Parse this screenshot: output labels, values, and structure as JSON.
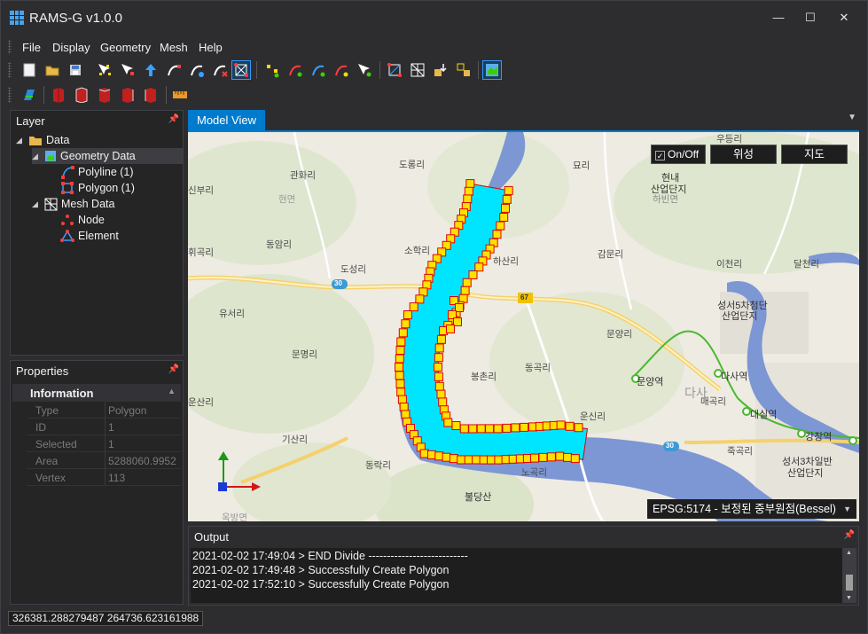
{
  "window": {
    "title": "RAMS-G v1.0.0",
    "minimize": "—",
    "maximize": "☐",
    "close": "✕"
  },
  "menu": [
    "File",
    "Display",
    "Geometry",
    "Mesh",
    "Help"
  ],
  "toolbar_icons_row1": [
    "new-file-icon",
    "open-folder-icon",
    "save-icon",
    "select-node-icon",
    "move-node-icon",
    "add-node-icon",
    "add-polyline-icon",
    "edit-polyline-icon",
    "delete-polyline-icon",
    "divide-polygon-icon",
    "select-point-icon",
    "polyline-point-icon",
    "add-line-icon",
    "merge-line-icon",
    "node-edit-icon",
    "create-polygon-icon",
    "mesh-grid-icon",
    "import-mesh-icon",
    "export-mesh-icon",
    "map-view-icon"
  ],
  "toolbar_icons_row2": [
    "interpolate-icon",
    "cube-red-1-icon",
    "cube-red-2-icon",
    "cube-red-3-icon",
    "cube-red-4-icon",
    "cube-red-5-icon",
    "ruler-icon"
  ],
  "layer": {
    "title": "Layer",
    "items": {
      "data": "Data",
      "geometry": "Geometry Data",
      "polyline": "Polyline (1)",
      "polygon": "Polygon (1)",
      "mesh": "Mesh Data",
      "node": "Node",
      "element": "Element"
    }
  },
  "properties": {
    "title": "Properties",
    "group": "Information",
    "rows": [
      {
        "key": "Type",
        "value": "Polygon"
      },
      {
        "key": "ID",
        "value": "1"
      },
      {
        "key": "Selected",
        "value": "1"
      },
      {
        "key": "Area",
        "value": "5288060.9952"
      },
      {
        "key": "Vertex",
        "value": "113"
      }
    ]
  },
  "model_view": {
    "tab": "Model View",
    "onoff_label": "On/Off",
    "satellite_btn": "위성",
    "map_btn": "지도",
    "crs": "EPSG:5174 - 보정된 중부원점(Bessel)",
    "map_labels": {
      "l1": "우등리",
      "l2": "관화리",
      "l3": "도롱리",
      "l4": "묘리",
      "l5": "현내",
      "l6": "산업단지",
      "l7": "신부리",
      "l8": "하빈면",
      "l9": "동암리",
      "l10": "소학리",
      "l11": "하산리",
      "l12": "감문리",
      "l13": "이천리",
      "l14": "달천리",
      "l15": "휘곡리",
      "l16": "도성리",
      "l17": "성서5차첨단",
      "l18": "산업단지",
      "l19": "유서리",
      "l20": "문양리",
      "l21": "문양역",
      "l22": "다사역",
      "l23": "문명리",
      "l24": "봉촌리",
      "l25": "동곡리",
      "l26": "매곡리",
      "l27": "대실역",
      "l28": "운산리",
      "l29": "운신리",
      "l30": "기산리",
      "l31": "죽곡리",
      "l32": "강창역",
      "l33": "성서3차일반",
      "l34": "산업단지",
      "l35": "동락리",
      "l36": "노곡리",
      "l37": "불당산",
      "l38": "다사",
      "l39": "현면",
      "l40": "옥방면",
      "road30a": "30",
      "road67": "67",
      "road30b": "30"
    }
  },
  "output": {
    "title": "Output",
    "lines": [
      "2021-02-02 17:49:04 > END Divide ---------------------------",
      "2021-02-02 17:49:48 > Successfully Create Polygon",
      "2021-02-02 17:52:10 > Successfully Create Polygon"
    ]
  },
  "status": {
    "coords": "326381.288279487 264736.623161988"
  },
  "colors": {
    "accent": "#007acc",
    "mesh_fill": "#00e5ff",
    "mesh_edge": "#e00000",
    "mesh_node": "#ffe000",
    "river": "#6e8bd0"
  }
}
